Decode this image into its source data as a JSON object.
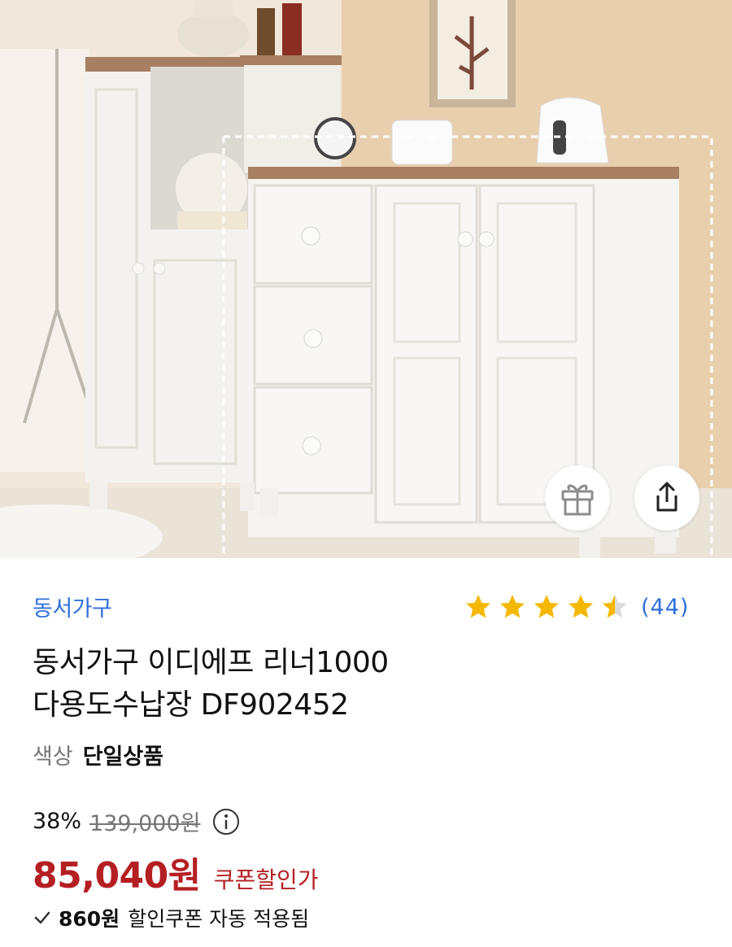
{
  "product_image": {
    "alt": "동서가구 이디에프 리너1000 다용도수납장"
  },
  "actions": {
    "gift_icon": "gift-icon",
    "share_icon": "share-icon"
  },
  "brand": "동서가구",
  "rating": {
    "stars": 4.5,
    "count_text": "(44)",
    "star_color": "#f5b800",
    "empty_star_color": "#dcdcdc"
  },
  "title": {
    "line1": "동서가구 이디에프 리너1000",
    "line2": "다용도수납장 DF902452"
  },
  "option": {
    "label": "색상",
    "value": "단일상품"
  },
  "pricing": {
    "discount_rate": "38%",
    "original_price": "139,000원",
    "info_icon": "info-icon",
    "final_price": "85,040원",
    "final_badge": "쿠폰할인가",
    "accent_color": "#b41f23"
  },
  "coupon": {
    "amount": "860원",
    "text": "할인쿠폰 자동 적용됨"
  },
  "colors": {
    "link_blue": "#2f6fdb"
  }
}
